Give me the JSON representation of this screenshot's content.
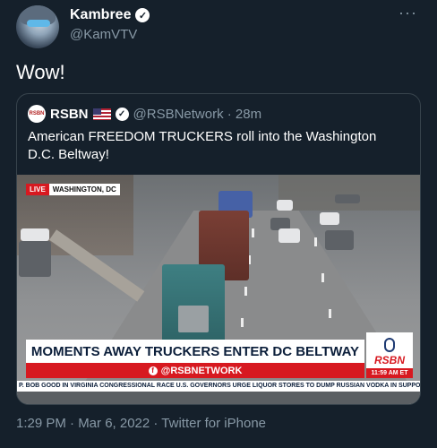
{
  "author": {
    "display_name": "Kambree",
    "handle": "@KamVTV",
    "verified_icon": "verified-badge-icon"
  },
  "more_icon": "···",
  "tweet": {
    "text": "Wow!",
    "meta": "1:29 PM · Mar 6, 2022 · Twitter for iPhone"
  },
  "quote": {
    "avatar_text": "RSBN",
    "display_name": "RSBN",
    "handle_time": "@RSBNetwork · 28m",
    "text": "American FREEDOM TRUCKERS roll into the Washington D.C. Beltway!",
    "video": {
      "live_label": "LIVE",
      "location": "WASHINGTON, DC",
      "headline": "MOMENTS AWAY TRUCKERS ENTER DC BELTWAY",
      "social_handle": "@RSBNETWORK",
      "fb_glyph": "f",
      "logo": "RSBN",
      "time": "11:59 AM ET",
      "ticker": "P. BOB GOOD IN VIRGINIA CONGRESSIONAL RACE    U.S. GOVERNORS URGE LIQUOR STORES TO DUMP RUSSIAN VODKA IN SUPPO"
    }
  },
  "colors": {
    "background": "#15202b",
    "secondary_text": "#8899a6",
    "border": "#38444d",
    "brand_red": "#d71920"
  }
}
